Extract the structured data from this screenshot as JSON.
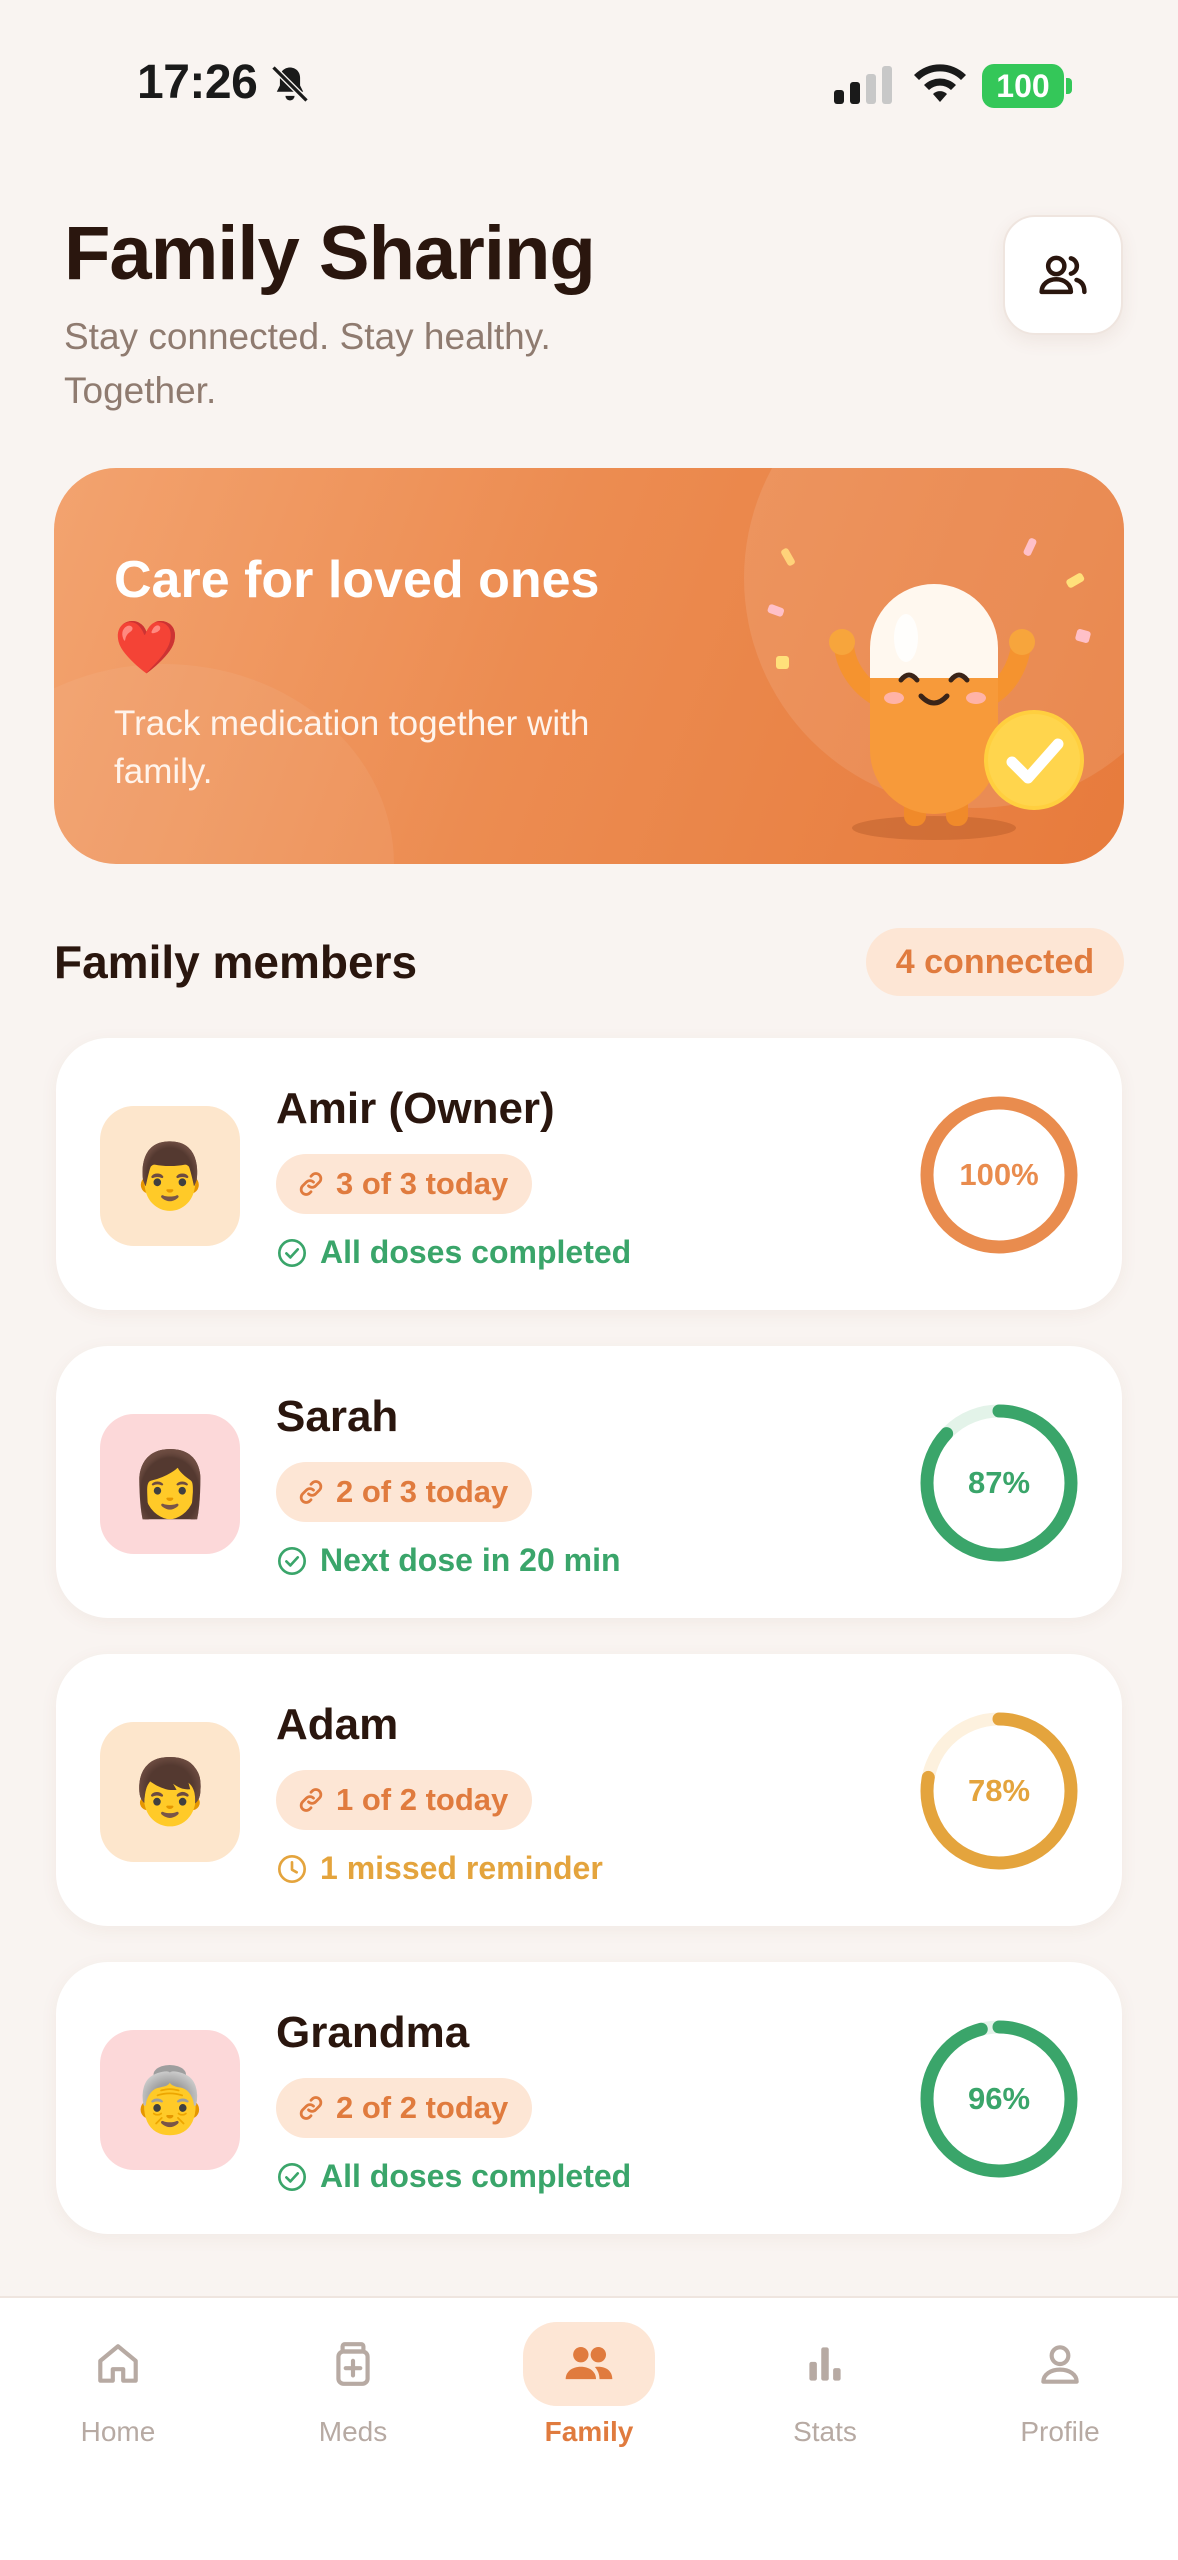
{
  "status_bar": {
    "time": "17:26",
    "battery": "100"
  },
  "header": {
    "title": "Family Sharing",
    "subtitle": "Stay connected. Stay healthy. Together.",
    "action_icon": "people-icon"
  },
  "hero": {
    "title": "Care for loved ones ❤️",
    "description": "Track medication together with family."
  },
  "members_section": {
    "title": "Family members",
    "badge": "4 connected"
  },
  "members": [
    {
      "name": "Amir (Owner)",
      "emoji": "👨",
      "avatar_color": "#fde6cc",
      "doses": "3 of 3 today",
      "status": "All doses completed",
      "status_icon": "check-circle-icon",
      "status_color": "#3aa56a",
      "percent_label": "100%",
      "progress": 1.0,
      "ring_color": "#e98c4e",
      "ring_track": "#fdeee3"
    },
    {
      "name": "Sarah",
      "emoji": "👩",
      "avatar_color": "#fcd8d9",
      "doses": "2 of 3 today",
      "status": "Next dose in 20 min",
      "status_icon": "check-circle-icon",
      "status_color": "#3aa56a",
      "percent_label": "87%",
      "progress": 0.87,
      "ring_color": "#3aa56a",
      "ring_track": "#e3f3e9"
    },
    {
      "name": "Adam",
      "emoji": "👦",
      "avatar_color": "#fde6cc",
      "doses": "1 of 2 today",
      "status": "1 missed reminder",
      "status_icon": "clock-icon",
      "status_color": "#e4a43d",
      "percent_label": "78%",
      "progress": 0.78,
      "ring_color": "#e4a43d",
      "ring_track": "#fdf1de"
    },
    {
      "name": "Grandma",
      "emoji": "👵",
      "avatar_color": "#fcd8d9",
      "doses": "2 of 2 today",
      "status": "All doses completed",
      "status_icon": "check-circle-icon",
      "status_color": "#3aa56a",
      "percent_label": "96%",
      "progress": 0.96,
      "ring_color": "#3aa56a",
      "ring_track": "#e3f3e9"
    }
  ],
  "nav": [
    {
      "label": "Home",
      "icon": "home-icon",
      "active": false
    },
    {
      "label": "Meds",
      "icon": "medicine-icon",
      "active": false
    },
    {
      "label": "Family",
      "icon": "family-icon",
      "active": true
    },
    {
      "label": "Stats",
      "icon": "bar-chart-icon",
      "active": false
    },
    {
      "label": "Profile",
      "icon": "user-icon",
      "active": false
    }
  ],
  "colors": {
    "accent": "#e07b3e",
    "background": "#f9f4f1",
    "success": "#3aa56a",
    "warning": "#e4a43d"
  }
}
